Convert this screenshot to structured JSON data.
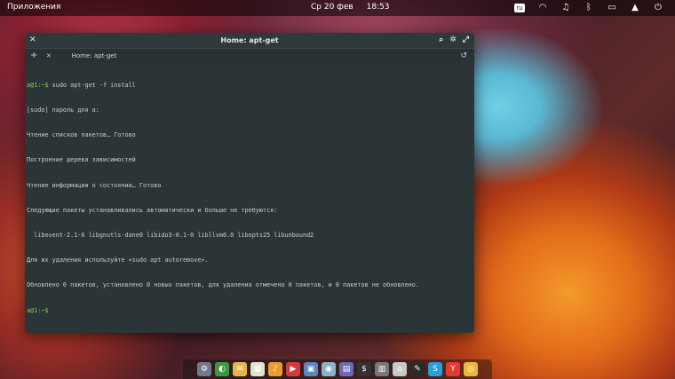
{
  "top_panel": {
    "apps_label": "Приложения",
    "date": "Ср 20 фев",
    "time": "18:53",
    "keyboard_layout": "ru"
  },
  "window": {
    "title": "Home: apt-get",
    "tab_title": "Home: apt-get",
    "colors": {
      "background": "#2b3437",
      "prompt": "#8cd14b",
      "text": "#c5ced1"
    }
  },
  "terminal": {
    "prompt_user": "a@1",
    "prompt_path": ":~$",
    "lines": [
      {
        "prompt": "a@1:~$",
        "text": " sudo apt-get -f install"
      },
      {
        "prompt": "",
        "text": "[sudo] пароль для a:"
      },
      {
        "prompt": "",
        "text": "Чтение списков пакетов… Готово"
      },
      {
        "prompt": "",
        "text": "Построение дерева зависимостей"
      },
      {
        "prompt": "",
        "text": "Чтение информации о состоянии… Готово"
      },
      {
        "prompt": "",
        "text": "Следующие пакеты устанавливались автоматически и больше не требуются:"
      },
      {
        "prompt": "",
        "text": "  libevent-2.1-6 libgnutls-dane0 libido3-0.1-0 libllvm6.0 libopts25 libunbound2"
      },
      {
        "prompt": "",
        "text": "Для их удаления используйте «sudo apt autoremove»."
      },
      {
        "prompt": "",
        "text": "Обновлено 0 пакетов, установлено 0 новых пакетов, для удаления отмечено 0 пакетов, и 0 пакетов не обновлено."
      },
      {
        "prompt": "a@1:~$",
        "text": ""
      }
    ]
  },
  "dock": {
    "items": [
      {
        "name": "system-settings-icon",
        "glyph": "⚙",
        "color": "#6f7a8a"
      },
      {
        "name": "browser-icon",
        "glyph": "◐",
        "color": "#3a9b3c"
      },
      {
        "name": "mail-icon",
        "glyph": "✉",
        "color": "#e7b54a"
      },
      {
        "name": "calendar-icon",
        "glyph": "▦",
        "color": "#dfe6c8"
      },
      {
        "name": "music-icon",
        "glyph": "♪",
        "color": "#f19a2c"
      },
      {
        "name": "video-icon",
        "glyph": "▶",
        "color": "#d53b3b"
      },
      {
        "name": "photos-icon",
        "glyph": "▣",
        "color": "#5a86c4"
      },
      {
        "name": "toggle-icon",
        "glyph": "◉",
        "color": "#8fb0c9"
      },
      {
        "name": "store-icon",
        "glyph": "▤",
        "color": "#6a6ab8"
      },
      {
        "name": "terminal-icon",
        "glyph": "$",
        "color": "#333333"
      },
      {
        "name": "tweaks-icon",
        "glyph": "▥",
        "color": "#777777"
      },
      {
        "name": "files-icon",
        "glyph": "⌂",
        "color": "#c9c9c9"
      },
      {
        "name": "scratch-icon",
        "glyph": "✎",
        "color": "#2b2b2b"
      },
      {
        "name": "skype-icon",
        "glyph": "S",
        "color": "#2a9de0"
      },
      {
        "name": "yandex-browser-icon",
        "glyph": "Y",
        "color": "#e23b2e"
      },
      {
        "name": "chrome-icon",
        "glyph": "◎",
        "color": "#e9b937"
      }
    ]
  }
}
